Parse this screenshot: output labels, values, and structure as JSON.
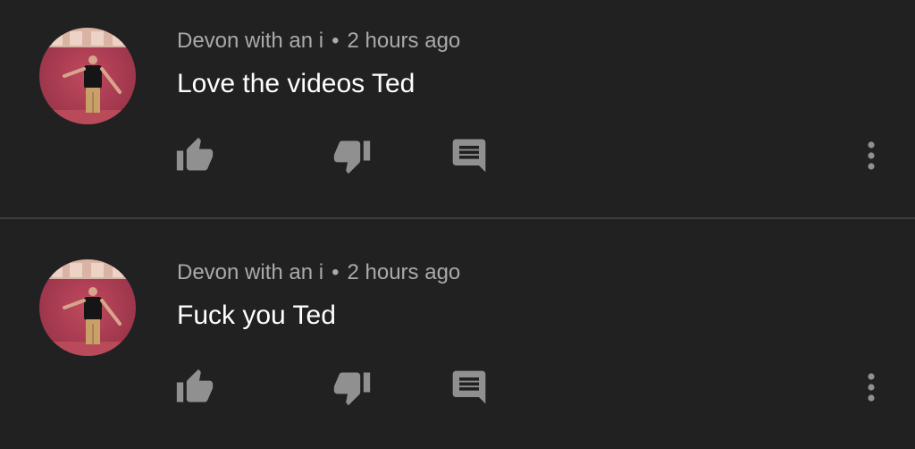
{
  "comments": [
    {
      "author": "Devon with an i",
      "separator": "•",
      "time": "2 hours ago",
      "text": "Love the videos Ted"
    },
    {
      "author": "Devon with an i",
      "separator": "•",
      "time": "2 hours ago",
      "text": "Fuck you Ted"
    }
  ],
  "icons": {
    "like": "thumb-up-icon",
    "dislike": "thumb-down-icon",
    "reply": "comment-icon",
    "menu": "more-vertical-icon"
  },
  "colors": {
    "background": "#212121",
    "divider": "#3d3d3d",
    "meta_text": "#aaaaaa",
    "comment_text": "#ffffff",
    "icon": "#909090"
  }
}
